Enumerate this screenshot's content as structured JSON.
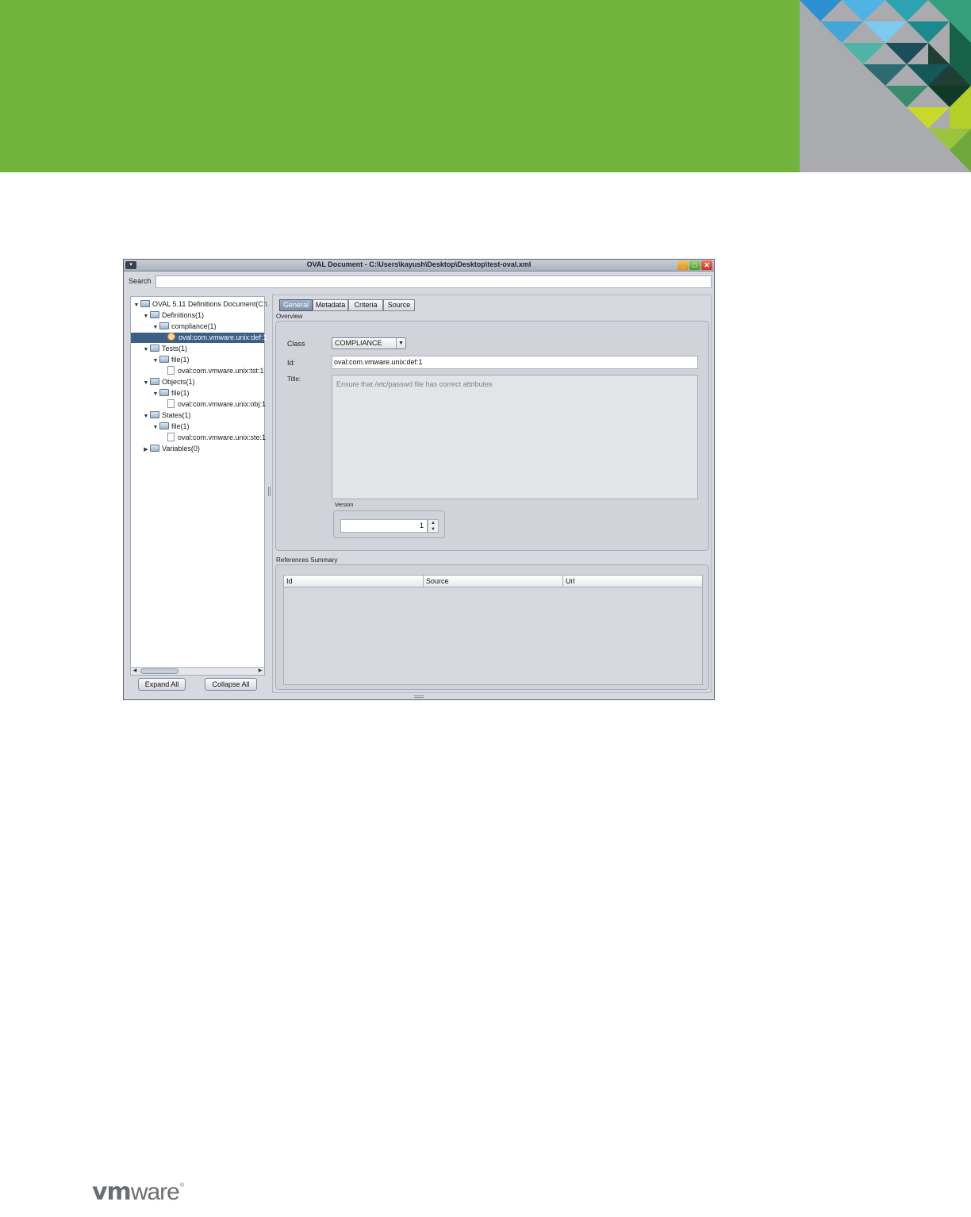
{
  "window": {
    "title": "OVAL Document - C:\\Users\\kayush\\Desktop\\Desktop\\test-oval.xml",
    "sys_menu_glyph": "▾",
    "min_glyph": "_",
    "max_glyph": "□",
    "close_glyph": "✕"
  },
  "search": {
    "label": "Search",
    "value": ""
  },
  "tree": {
    "expanded_glyph": "▼",
    "collapsed_glyph": "▶",
    "items": [
      {
        "label": "OVAL 5.11 Definitions Document(C:\\",
        "icon": "folder-icon",
        "expanded": true
      },
      {
        "label": "Definitions(1)",
        "icon": "folder-icon",
        "expanded": true
      },
      {
        "label": "compliance(1)",
        "icon": "folder-icon",
        "expanded": true
      },
      {
        "label": "oval:com.vmware.unix:def:1",
        "icon": "definition-icon",
        "selected": true
      },
      {
        "label": "Tests(1)",
        "icon": "folder-icon",
        "expanded": true
      },
      {
        "label": "file(1)",
        "icon": "folder-icon",
        "expanded": true
      },
      {
        "label": "oval:com.vmware.unix:tst:1",
        "icon": "file-icon"
      },
      {
        "label": "Objects(1)",
        "icon": "folder-icon",
        "expanded": true
      },
      {
        "label": "file(1)",
        "icon": "folder-icon",
        "expanded": true
      },
      {
        "label": "oval:com.vmware.unix:obj:1",
        "icon": "file-icon"
      },
      {
        "label": "States(1)",
        "icon": "folder-icon",
        "expanded": true
      },
      {
        "label": "file(1)",
        "icon": "folder-icon",
        "expanded": true
      },
      {
        "label": "oval:com.vmware.unix:ste:1",
        "icon": "file-icon"
      },
      {
        "label": "Variables(0)",
        "icon": "folder-icon",
        "expanded": false
      }
    ],
    "scroll_left_glyph": "◀",
    "scroll_right_glyph": "▶"
  },
  "buttons": {
    "expand_all": "Expand All",
    "collapse_all": "Collapse All"
  },
  "tabs": [
    {
      "label": "General",
      "active": true
    },
    {
      "label": "Metadata",
      "active": false
    },
    {
      "label": "Criteria",
      "active": false
    },
    {
      "label": "Source",
      "active": false
    }
  ],
  "overview": {
    "group_label": "Overview",
    "class_label": "Class",
    "class_value": "COMPLIANCE",
    "combo_arrow": "▼",
    "id_label": "Id:",
    "id_value": "oval:com.vmware.unix:def:1",
    "title_label": "Title:",
    "title_value": "Ensure that /etc/passwd file has correct attributes",
    "version_label": "Version",
    "version_value": "1",
    "spin_up": "▲",
    "spin_down": "▼"
  },
  "references": {
    "group_label": "References Summary",
    "columns": [
      "Id",
      "Source",
      "Url"
    ]
  },
  "logo": {
    "text_bold": "vm",
    "text_regular": "ware",
    "reg_mark": "®"
  },
  "colors": {
    "banner_green": "#70b43e",
    "window_bg": "#d6d9df",
    "selection": "#3b5f86",
    "logo_gray": "#6b6e71"
  }
}
